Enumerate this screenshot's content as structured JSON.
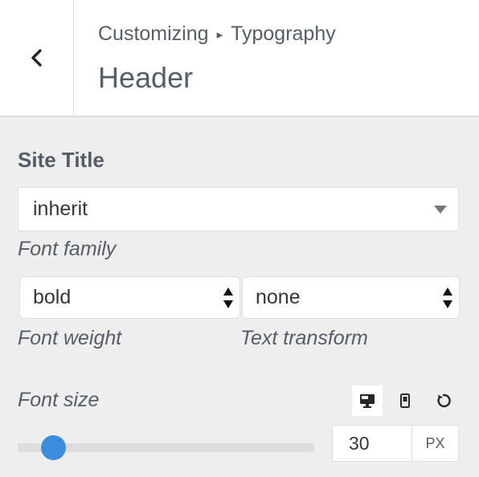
{
  "header": {
    "breadcrumb": {
      "parent": "Customizing",
      "separator": "▸",
      "current": "Typography"
    },
    "title": "Header"
  },
  "section": {
    "title": "Site Title"
  },
  "font_family": {
    "value": "inherit",
    "description": "Font family"
  },
  "font_weight": {
    "value": "bold",
    "description": "Font weight"
  },
  "text_transform": {
    "value": "none",
    "description": "Text transform"
  },
  "font_size": {
    "label": "Font size",
    "value": "30",
    "unit": "PX",
    "slider_fraction": 0.12,
    "devices": [
      "desktop-icon",
      "mobile-icon"
    ],
    "reset_icon": "reset-icon"
  },
  "colors": {
    "accent": "#3c8dde",
    "panel": "#eeeeee",
    "text": "#555d66"
  }
}
